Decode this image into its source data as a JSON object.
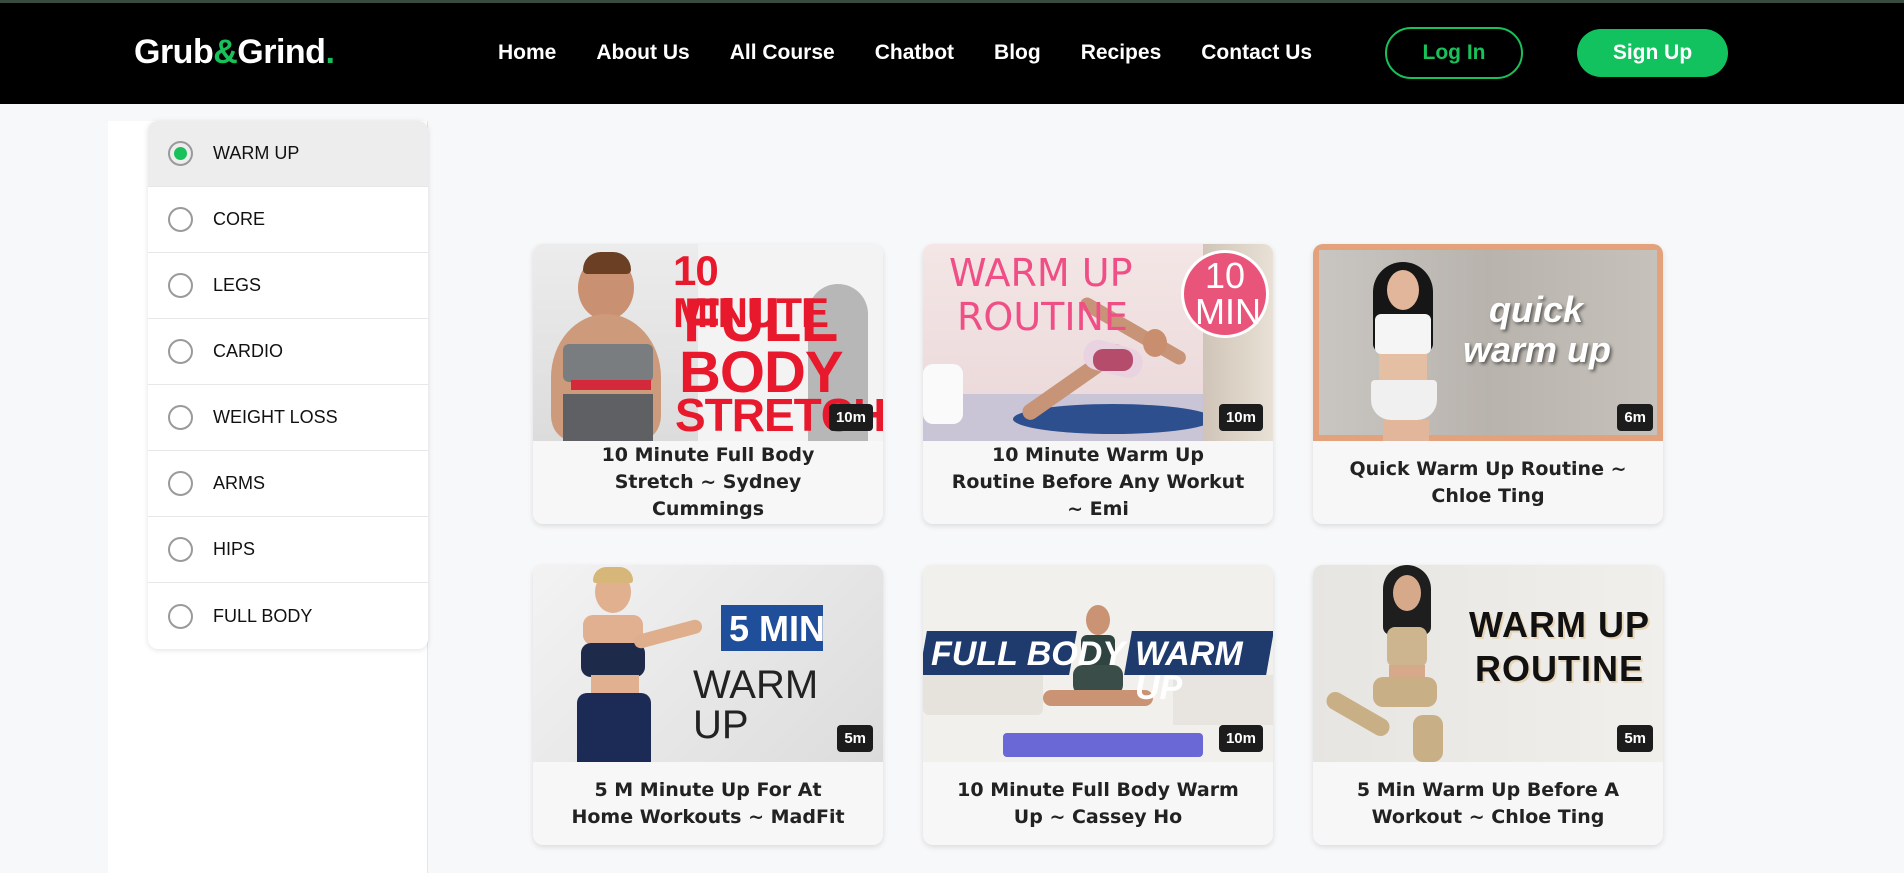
{
  "brand": {
    "name_part1": "Grub",
    "amp": "&",
    "name_part2": "Grind",
    "dot": "."
  },
  "nav": [
    "Home",
    "About Us",
    "All Course",
    "Chatbot",
    "Blog",
    "Recipes",
    "Contact Us"
  ],
  "auth": {
    "login": "Log In",
    "signup": "Sign Up"
  },
  "colors": {
    "accent": "#19c15b",
    "header_bg": "#000000"
  },
  "filters": [
    {
      "label": "WARM UP",
      "selected": true
    },
    {
      "label": "CORE",
      "selected": false
    },
    {
      "label": "LEGS",
      "selected": false
    },
    {
      "label": "CARDIO",
      "selected": false
    },
    {
      "label": "WEIGHT LOSS",
      "selected": false
    },
    {
      "label": "ARMS",
      "selected": false
    },
    {
      "label": "HIPS",
      "selected": false
    },
    {
      "label": "FULL BODY",
      "selected": false
    }
  ],
  "videos": [
    {
      "title": "10 Minute Full Body Stretch ~ Sydney Cummings",
      "duration": "10m",
      "thumb_text": [
        "10 MINUTE",
        "FULL",
        "BODY",
        "STRETCH"
      ]
    },
    {
      "title": "10 Minute Warm Up Routine Before Any Workut ~ Emi",
      "duration": "10m",
      "thumb_text": [
        "WARM UP",
        "ROUTINE",
        "10",
        "MIN"
      ]
    },
    {
      "title": "Quick Warm Up Routine ~ Chloe Ting",
      "duration": "6m",
      "thumb_text": [
        "quick",
        "warm up"
      ]
    },
    {
      "title": "5 M Minute Up For At Home Workouts ~ MadFit",
      "duration": "5m",
      "thumb_text": [
        "5 MIN",
        "WARM UP"
      ]
    },
    {
      "title": "10 Minute Full Body Warm Up ~ Cassey Ho",
      "duration": "10m",
      "thumb_text": [
        "FULL BODY",
        "WARM UP"
      ]
    },
    {
      "title": "5 Min Warm Up Before A Workout ~ Chloe Ting",
      "duration": "5m",
      "thumb_text": [
        "WARM UP",
        "ROUTINE"
      ]
    }
  ]
}
